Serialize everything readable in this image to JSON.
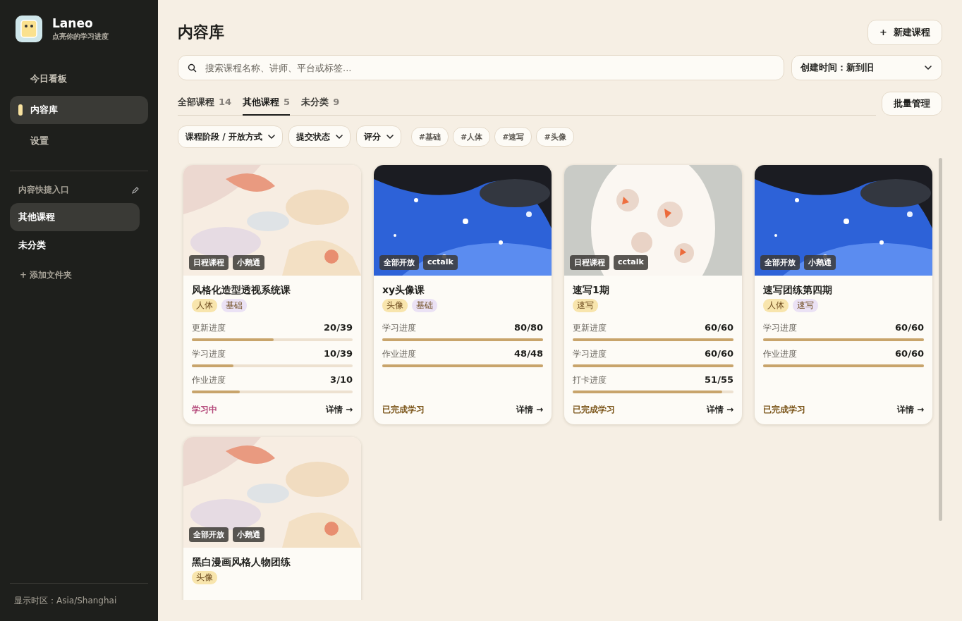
{
  "sidebar": {
    "app_name": "Laneo",
    "tagline": "点亮你的学习进度",
    "nav": [
      {
        "label": "今日看板",
        "selected": false
      },
      {
        "label": "内容库",
        "selected": true
      },
      {
        "label": "设置",
        "selected": false
      }
    ],
    "shortcuts_title": "内容快捷入口",
    "shortcuts": [
      {
        "label": "其他课程",
        "selected": true
      },
      {
        "label": "未分类",
        "selected": false
      }
    ],
    "add_folder": "+ 添加文件夹",
    "timezone": "显示时区：Asia/Shanghai"
  },
  "page_title": "内容库",
  "new_button": "+  新建课程",
  "search": {
    "placeholder": "搜索课程名称、讲师、平台或标签..."
  },
  "sort": {
    "value": "创建时间：新到旧"
  },
  "tabs": [
    {
      "label": "全部课程",
      "count": "14",
      "selected": false
    },
    {
      "label": "其他课程",
      "count": "5",
      "selected": true
    },
    {
      "label": "未分类",
      "count": "9",
      "selected": false
    }
  ],
  "batch_button": "批量管理",
  "filters": [
    "课程阶段 / 开放方式",
    "提交状态",
    "评分"
  ],
  "tag_chips": [
    "#基础",
    "#人体",
    "#速写",
    "#头像"
  ],
  "courses": [
    {
      "badges": [
        "日程课程",
        "小鹅通"
      ],
      "title": "风格化造型透视系统课",
      "tags": [
        {
          "label": "人体",
          "color": "#f8e5ad"
        },
        {
          "label": "基础",
          "color": "#ebe2f5"
        }
      ],
      "progress": [
        {
          "label": "更新进度",
          "value": "20/39",
          "level": 0.51
        },
        {
          "label": "学习进度",
          "value": "10/39",
          "level": 0.26
        },
        {
          "label": "作业进度",
          "value": "3/10",
          "level": 0.3
        }
      ],
      "status": {
        "text": "学习中",
        "kind": "active"
      },
      "detail": "详情 →"
    },
    {
      "badges": [
        "全部开放",
        "cctalk"
      ],
      "title": "xy头像课",
      "tags": [
        {
          "label": "头像",
          "color": "#f8e5ad"
        },
        {
          "label": "基础",
          "color": "#ebe2f5"
        }
      ],
      "progress": [
        {
          "label": "学习进度",
          "value": "80/80",
          "level": 1
        },
        {
          "label": "作业进度",
          "value": "48/48",
          "level": 1
        }
      ],
      "status": {
        "text": "已完成学习",
        "kind": "done"
      },
      "detail": "详情 →"
    },
    {
      "badges": [
        "日程课程",
        "cctalk"
      ],
      "title": "速写1期",
      "tags": [
        {
          "label": "速写",
          "color": "#f8e5ad"
        }
      ],
      "progress": [
        {
          "label": "更新进度",
          "value": "60/60",
          "level": 1
        },
        {
          "label": "学习进度",
          "value": "60/60",
          "level": 1
        },
        {
          "label": "打卡进度",
          "value": "51/55",
          "level": 0.93
        }
      ],
      "status": {
        "text": "已完成学习",
        "kind": "done"
      },
      "detail": "详情 →"
    },
    {
      "badges": [
        "全部开放",
        "小鹅通"
      ],
      "title": "速写团练第四期",
      "tags": [
        {
          "label": "人体",
          "color": "#f8e5ad"
        },
        {
          "label": "速写",
          "color": "#ebe2f5"
        }
      ],
      "progress": [
        {
          "label": "学习进度",
          "value": "60/60",
          "level": 1
        },
        {
          "label": "作业进度",
          "value": "60/60",
          "level": 1
        }
      ],
      "status": {
        "text": "已完成学习",
        "kind": "done"
      },
      "detail": "详情 →"
    },
    {
      "badges": [
        "全部开放",
        "小鹅通"
      ],
      "title": "黑白漫画风格人物团练",
      "tags": [
        {
          "label": "头像",
          "color": "#f8e5ad"
        }
      ]
    }
  ]
}
